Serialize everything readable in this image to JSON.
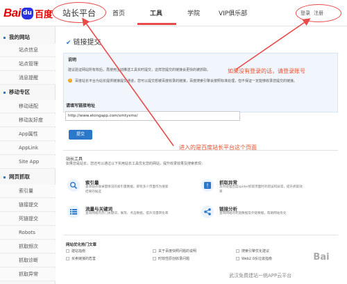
{
  "topbar": {
    "logo_bai": "Bai",
    "logo_du": "du",
    "logo_cn": "百度",
    "site_title": "站长平台",
    "nav": [
      "首页",
      "工具",
      "学院",
      "VIP俱乐部"
    ],
    "login": "登录",
    "register": "注册"
  },
  "sidebar": {
    "sections": [
      {
        "label": "我的网站",
        "items": [
          "站点信息",
          "站点管理",
          "消息提醒"
        ]
      },
      {
        "label": "移动专区",
        "items": [
          "移动适配",
          "移动友好度",
          "App属性",
          "AppLink",
          "Site App"
        ]
      },
      {
        "label": "网页抓取",
        "items": [
          "索引量",
          "链接提交",
          "死链提交",
          "Robots",
          "抓取频次",
          "抓取诊断",
          "抓取异常"
        ]
      }
    ]
  },
  "main": {
    "heading": "链接提交",
    "desc_label": "说明",
    "desc_line1": "建议验证网站所有权后，再使用主动推送工具实时提交，这样您提交的链接会更快的被抓取。",
    "desc_line2": "百度站长平台为站长提供链接提交通道，您可以提交想被百度收录的链接，百度搜索引擎会按照标准处理，但不保证一定能够收录您提交的链接。",
    "url_label": "请填写链接地址",
    "url_value": "http://www.etongapp.com/xmtyxms/",
    "submit_label": "提交",
    "tools_title": "站长工具",
    "tools_sub": "如果您是站长，您还可以通过以下实用站长工具优化您的网站，提升收录效果及搜索表现：",
    "tools": [
      {
        "name": "索引量",
        "desc": "查询站点收录量情况的索引量数据，即有多少页面作为搜索结果的候选"
      },
      {
        "name": "抓取异常",
        "desc": "及时处理百度spider抓取页面时的错误和异常，提升抓取效率"
      },
      {
        "name": "流量与关键词",
        "desc": "查询网站的热门关键词，展现、点击数据，提升流量转化率"
      },
      {
        "name": "链接分析",
        "desc": "查询网站的死链数据及外链数据，帮助网站优化"
      }
    ],
    "links_title": "网站优化热门文章",
    "links": [
      "建站指南",
      "关于百度快照问题的说明",
      "搜索引擎优化建议",
      "买卖链接的危害",
      "时效性原创收录问题",
      "Web2.0反垃圾指南"
    ]
  },
  "annotations": {
    "note_login": "如果没有登录的话，请登录账号",
    "note_page": "进入的是百度站长平台这个页面",
    "watermark": "武汉免费建站一统APP云平台",
    "wm_logo": "Bai"
  },
  "colors": {
    "accent": "#2b77c9",
    "annotation": "#e94a4a",
    "brand_red": "#e10601"
  }
}
